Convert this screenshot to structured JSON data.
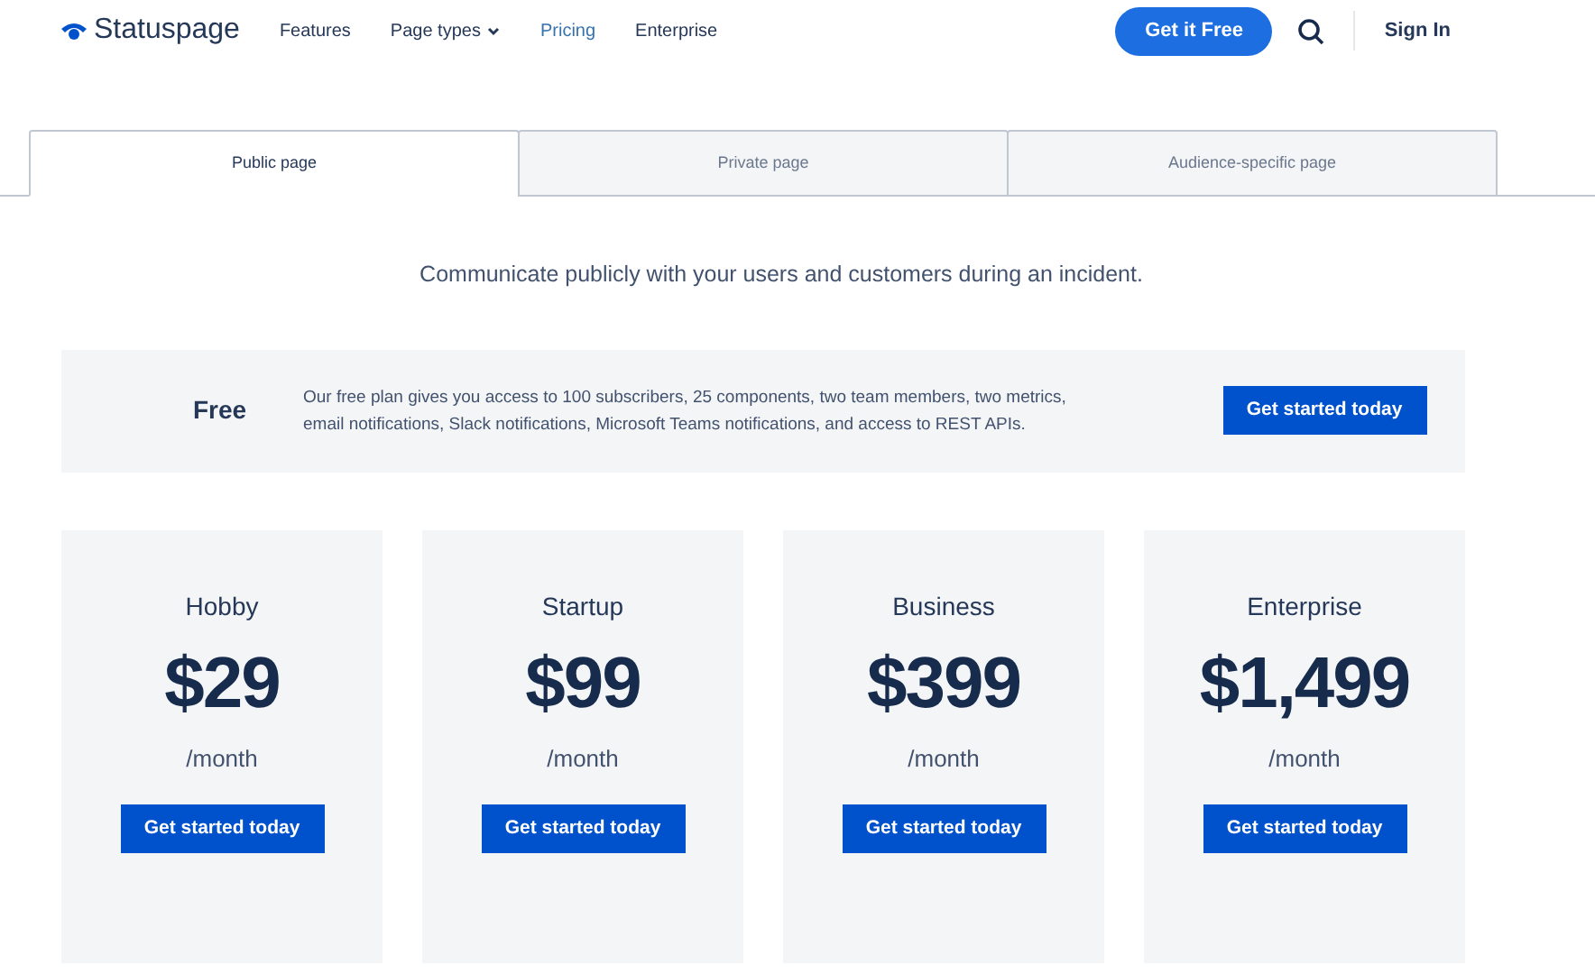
{
  "nav": {
    "logo": "Statuspage",
    "items": [
      {
        "label": "Features",
        "selected": false,
        "dropdown": false
      },
      {
        "label": "Page types",
        "selected": false,
        "dropdown": true
      },
      {
        "label": "Pricing",
        "selected": true,
        "dropdown": false
      },
      {
        "label": "Enterprise",
        "selected": false,
        "dropdown": false
      }
    ],
    "cta": "Get it Free",
    "sign_in": "Sign In"
  },
  "tabs": [
    {
      "label": "Public page",
      "selected": true
    },
    {
      "label": "Private page",
      "selected": false
    },
    {
      "label": "Audience-specific page",
      "selected": false
    }
  ],
  "intro": "Communicate publicly with your users and customers during an incident.",
  "free_plan": {
    "name": "Free",
    "description": "Our free plan gives you access to 100 subscribers, 25 components, two team members, two metrics, email notifications, Slack notifications, Microsoft Teams notifications, and access to REST APIs.",
    "button": "Get started today"
  },
  "plans": [
    {
      "name": "Hobby",
      "price": "$29",
      "period": "/month",
      "button": "Get started today"
    },
    {
      "name": "Startup",
      "price": "$99",
      "period": "/month",
      "button": "Get started today"
    },
    {
      "name": "Business",
      "price": "$399",
      "period": "/month",
      "button": "Get started today"
    },
    {
      "name": "Enterprise",
      "price": "$1,499",
      "period": "/month",
      "button": "Get started today"
    }
  ]
}
